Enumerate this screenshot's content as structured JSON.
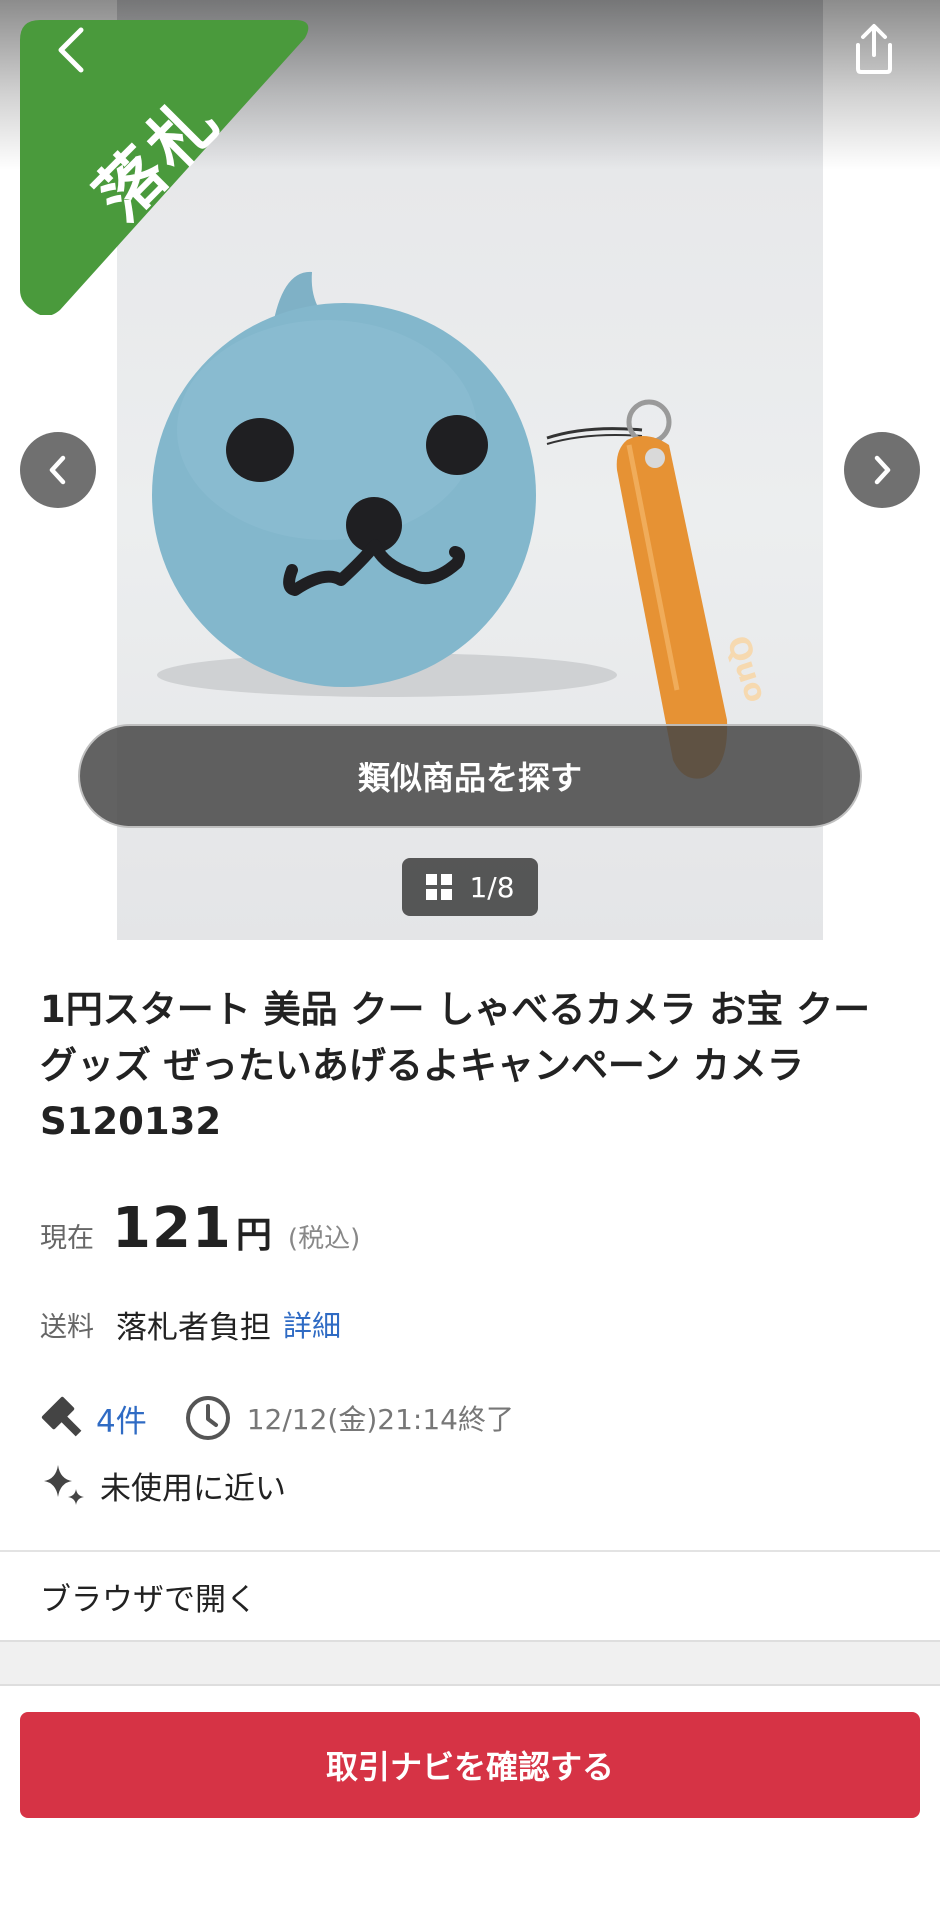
{
  "header": {
    "sold_badge": "落札"
  },
  "gallery": {
    "similar_button": "類似商品を探す",
    "counter": "1/8",
    "strap_text": "Quo"
  },
  "item": {
    "title": "1円スタート 美品 クー しゃべるカメラ お宝 クーグッズ ぜったいあげるよキャンペーン カメラ S120132",
    "price_label": "現在",
    "price_value": "121",
    "price_unit": "円",
    "price_tax": "(税込)",
    "shipping_label": "送料",
    "shipping_value": "落札者負担",
    "shipping_link": "詳細",
    "bids": "4件",
    "end_time": "12/12(金)21:14終了",
    "condition": "未使用に近い"
  },
  "actions": {
    "open_browser": "ブラウザで開く",
    "primary_button": "取引ナビを確認する"
  },
  "colors": {
    "sold_green": "#4a9a3c",
    "link_blue": "#2f6bc4",
    "cta_red": "#d63345"
  },
  "icons": [
    "back-icon",
    "share-icon",
    "chevron-left-icon",
    "chevron-right-icon",
    "grid-icon",
    "gavel-icon",
    "clock-icon",
    "sparkle-icon"
  ]
}
